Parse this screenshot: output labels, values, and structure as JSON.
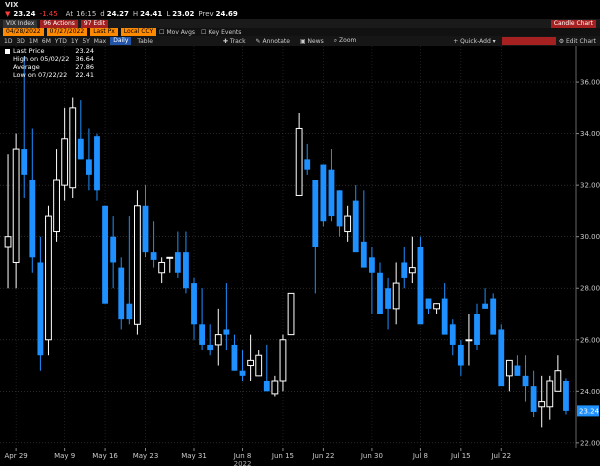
{
  "header": {
    "ticker": "VIX",
    "last": "23.24",
    "change": "-1.45",
    "at_label": "At",
    "time": "16:15",
    "open_label": "d",
    "open": "24.27",
    "high_label": "H",
    "high": "24.41",
    "low_label": "L",
    "low": "23.02",
    "prev_label": "Prev",
    "prev": "24.69"
  },
  "toolbar": {
    "security": "VIX Index",
    "actions_label": "96 Actions",
    "edit_label": "97 Edit",
    "title": "Candle Chart",
    "start_date": "04/28/2022",
    "end_date": "07/27/2022",
    "field": "Last Px",
    "currency": "Local CCY",
    "mov_avgs": "Mov Avgs",
    "key_events": "Key Events",
    "periods": [
      "1D",
      "3D",
      "1M",
      "6M",
      "YTD",
      "1Y",
      "5Y",
      "Max"
    ],
    "active_period": "Daily",
    "table_label": "Table",
    "track": "Track",
    "annotate": "Annotate",
    "news": "News",
    "zoom": "Zoom",
    "quick_add": "Quick-Add",
    "edit_chart": "Edit Chart"
  },
  "chart_data": {
    "type": "candlestick",
    "ylim": [
      21.8,
      37.4
    ],
    "y_ticks": [
      "22.00",
      "24.00",
      "26.00",
      "28.00",
      "30.00",
      "32.00",
      "34.00",
      "36.00"
    ],
    "x_tick_labels": [
      "Apr 29",
      "May 9",
      "May 16",
      "May 23",
      "May 31",
      "Jun 8",
      "Jun 15",
      "Jun 22",
      "Jun 30",
      "Jul 8",
      "Jul 15",
      "Jul 22"
    ],
    "x_tick_index": [
      1,
      7,
      12,
      17,
      23,
      29,
      34,
      39,
      45,
      51,
      56,
      61
    ],
    "year_label": "2022",
    "last_price_label": "23.24",
    "series_color_up": "#ffffff",
    "series_color_down": "#1e90ff",
    "candles": [
      {
        "o": 29.6,
        "h": 33.2,
        "l": 28.0,
        "c": 30.0
      },
      {
        "o": 29.0,
        "h": 34.0,
        "l": 28.0,
        "c": 33.4
      },
      {
        "o": 33.4,
        "h": 37.0,
        "l": 31.5,
        "c": 32.4
      },
      {
        "o": 32.2,
        "h": 34.2,
        "l": 28.6,
        "c": 29.2
      },
      {
        "o": 29.0,
        "h": 30.0,
        "l": 24.8,
        "c": 25.4
      },
      {
        "o": 26.0,
        "h": 31.2,
        "l": 25.4,
        "c": 30.8
      },
      {
        "o": 30.2,
        "h": 33.4,
        "l": 29.8,
        "c": 32.2
      },
      {
        "o": 32.0,
        "h": 35.0,
        "l": 31.4,
        "c": 33.8
      },
      {
        "o": 31.9,
        "h": 35.4,
        "l": 31.5,
        "c": 35.0
      },
      {
        "o": 33.8,
        "h": 35.3,
        "l": 33.0,
        "c": 33.0
      },
      {
        "o": 33.0,
        "h": 34.2,
        "l": 31.8,
        "c": 32.4
      },
      {
        "o": 33.9,
        "h": 34.0,
        "l": 31.4,
        "c": 31.8
      },
      {
        "o": 31.2,
        "h": 31.2,
        "l": 27.4,
        "c": 27.4
      },
      {
        "o": 30.0,
        "h": 30.8,
        "l": 28.0,
        "c": 29.0
      },
      {
        "o": 28.8,
        "h": 29.2,
        "l": 26.4,
        "c": 26.8
      },
      {
        "o": 27.4,
        "h": 30.8,
        "l": 26.6,
        "c": 26.8
      },
      {
        "o": 26.6,
        "h": 31.8,
        "l": 26.2,
        "c": 31.2
      },
      {
        "o": 31.2,
        "h": 32.0,
        "l": 29.2,
        "c": 29.4
      },
      {
        "o": 29.4,
        "h": 30.6,
        "l": 28.8,
        "c": 29.1
      },
      {
        "o": 28.6,
        "h": 29.2,
        "l": 28.2,
        "c": 29.0
      },
      {
        "o": 29.2,
        "h": 29.2,
        "l": 28.6,
        "c": 29.2
      },
      {
        "o": 29.4,
        "h": 30.2,
        "l": 28.4,
        "c": 28.6
      },
      {
        "o": 29.4,
        "h": 30.2,
        "l": 27.8,
        "c": 28.0
      },
      {
        "o": 28.2,
        "h": 28.4,
        "l": 26.0,
        "c": 26.6
      },
      {
        "o": 26.6,
        "h": 28.0,
        "l": 25.6,
        "c": 25.8
      },
      {
        "o": 25.8,
        "h": 26.6,
        "l": 25.4,
        "c": 25.6
      },
      {
        "o": 25.8,
        "h": 27.2,
        "l": 25.0,
        "c": 26.2
      },
      {
        "o": 26.4,
        "h": 28.2,
        "l": 25.6,
        "c": 26.2
      },
      {
        "o": 25.8,
        "h": 26.2,
        "l": 24.8,
        "c": 24.8
      },
      {
        "o": 24.8,
        "h": 25.6,
        "l": 24.4,
        "c": 24.6
      },
      {
        "o": 25.0,
        "h": 26.2,
        "l": 24.4,
        "c": 25.2
      },
      {
        "o": 24.6,
        "h": 25.6,
        "l": 24.6,
        "c": 25.4
      },
      {
        "o": 24.4,
        "h": 25.8,
        "l": 24.0,
        "c": 24.0
      },
      {
        "o": 23.9,
        "h": 24.6,
        "l": 23.8,
        "c": 24.4
      },
      {
        "o": 24.4,
        "h": 26.2,
        "l": 24.0,
        "c": 26.0
      },
      {
        "o": 26.2,
        "h": 27.6,
        "l": 26.2,
        "c": 27.8
      },
      {
        "o": 31.6,
        "h": 34.8,
        "l": 31.6,
        "c": 34.2
      },
      {
        "o": 33.0,
        "h": 33.6,
        "l": 32.4,
        "c": 32.6
      },
      {
        "o": 32.2,
        "h": 32.2,
        "l": 27.8,
        "c": 29.6
      },
      {
        "o": 32.8,
        "h": 32.8,
        "l": 30.4,
        "c": 30.6
      },
      {
        "o": 32.6,
        "h": 33.4,
        "l": 30.6,
        "c": 30.8
      },
      {
        "o": 31.8,
        "h": 31.8,
        "l": 30.0,
        "c": 30.4
      },
      {
        "o": 30.2,
        "h": 31.2,
        "l": 29.8,
        "c": 30.8
      },
      {
        "o": 31.4,
        "h": 32.0,
        "l": 30.0,
        "c": 29.4
      },
      {
        "o": 29.8,
        "h": 31.8,
        "l": 29.0,
        "c": 28.8
      },
      {
        "o": 29.2,
        "h": 29.6,
        "l": 27.0,
        "c": 28.6
      },
      {
        "o": 28.6,
        "h": 29.0,
        "l": 27.2,
        "c": 27.0
      },
      {
        "o": 28.0,
        "h": 28.4,
        "l": 26.4,
        "c": 27.2
      },
      {
        "o": 27.2,
        "h": 29.0,
        "l": 26.6,
        "c": 28.2
      },
      {
        "o": 29.0,
        "h": 29.6,
        "l": 28.0,
        "c": 28.4
      },
      {
        "o": 28.6,
        "h": 30.0,
        "l": 28.2,
        "c": 28.8
      },
      {
        "o": 29.6,
        "h": 30.0,
        "l": 28.4,
        "c": 26.6
      },
      {
        "o": 27.6,
        "h": 27.6,
        "l": 27.0,
        "c": 27.2
      },
      {
        "o": 27.2,
        "h": 27.4,
        "l": 27.0,
        "c": 27.4
      },
      {
        "o": 27.6,
        "h": 28.2,
        "l": 27.2,
        "c": 26.2
      },
      {
        "o": 26.6,
        "h": 26.8,
        "l": 25.4,
        "c": 25.8
      },
      {
        "o": 25.8,
        "h": 26.0,
        "l": 24.6,
        "c": 25.0
      },
      {
        "o": 26.0,
        "h": 27.0,
        "l": 25.0,
        "c": 26.0
      },
      {
        "o": 27.0,
        "h": 27.4,
        "l": 25.6,
        "c": 25.8
      },
      {
        "o": 27.4,
        "h": 28.0,
        "l": 27.2,
        "c": 27.2
      },
      {
        "o": 27.6,
        "h": 27.8,
        "l": 26.4,
        "c": 26.2
      },
      {
        "o": 26.4,
        "h": 26.6,
        "l": 24.6,
        "c": 24.2
      },
      {
        "o": 24.6,
        "h": 25.2,
        "l": 24.0,
        "c": 25.2
      },
      {
        "o": 25.0,
        "h": 25.4,
        "l": 24.6,
        "c": 24.6
      },
      {
        "o": 24.6,
        "h": 25.4,
        "l": 23.6,
        "c": 24.2
      },
      {
        "o": 24.2,
        "h": 24.8,
        "l": 23.0,
        "c": 23.2
      },
      {
        "o": 23.4,
        "h": 24.6,
        "l": 22.6,
        "c": 23.6
      },
      {
        "o": 23.4,
        "h": 24.6,
        "l": 22.9,
        "c": 24.4
      },
      {
        "o": 24.0,
        "h": 25.4,
        "l": 24.0,
        "c": 24.8
      },
      {
        "o": 24.4,
        "h": 24.5,
        "l": 23.1,
        "c": 23.24
      }
    ]
  },
  "legend": {
    "items": [
      {
        "label": "Last Price",
        "value": "23.24"
      },
      {
        "label": "High on 05/02/22",
        "value": "36.64"
      },
      {
        "label": "Average",
        "value": "27.86"
      },
      {
        "label": "Low on 07/22/22",
        "value": "22.41"
      }
    ]
  }
}
